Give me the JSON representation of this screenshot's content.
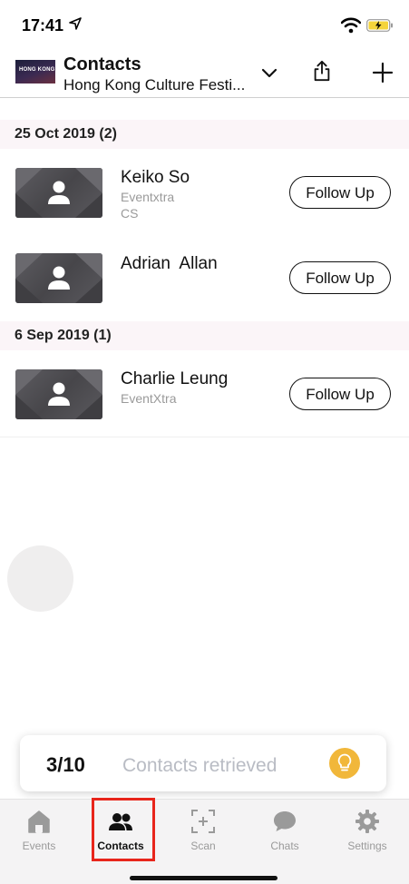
{
  "status_bar": {
    "time": "17:41",
    "icons": [
      "location-arrow-icon",
      "wifi-icon",
      "battery-charging-icon"
    ]
  },
  "header": {
    "event_thumbnail_text": "HONG KONG",
    "title": "Contacts",
    "subtitle": "Hong Kong Culture Festi...",
    "icons": [
      "chevron-down-icon",
      "share-icon",
      "plus-icon"
    ]
  },
  "sections": [
    {
      "label": "25 Oct 2019 (2)",
      "contacts": [
        {
          "name": "Keiko So",
          "company": "Eventxtra",
          "title": "CS",
          "button": "Follow Up"
        },
        {
          "name": "Adrian  Allan",
          "company": "",
          "title": "",
          "button": "Follow Up"
        }
      ]
    },
    {
      "label": "6 Sep 2019 (1)",
      "contacts": [
        {
          "name": "Charlie Leung",
          "company": "EventXtra",
          "title": "",
          "button": "Follow Up"
        }
      ]
    }
  ],
  "toast": {
    "count": "3/10",
    "text": "Contacts retrieved",
    "icon": "lightbulb-icon"
  },
  "tab_bar": {
    "active": "Contacts",
    "tabs": [
      {
        "label": "Events",
        "icon": "home-icon"
      },
      {
        "label": "Contacts",
        "icon": "people-icon"
      },
      {
        "label": "Scan",
        "icon": "scan-icon"
      },
      {
        "label": "Chats",
        "icon": "chat-bubble-icon"
      },
      {
        "label": "Settings",
        "icon": "gear-icon"
      }
    ]
  },
  "colors": {
    "highlight": "#e8251b",
    "section_bg": "#fbf5f8",
    "bulb": "#f1b73a"
  }
}
